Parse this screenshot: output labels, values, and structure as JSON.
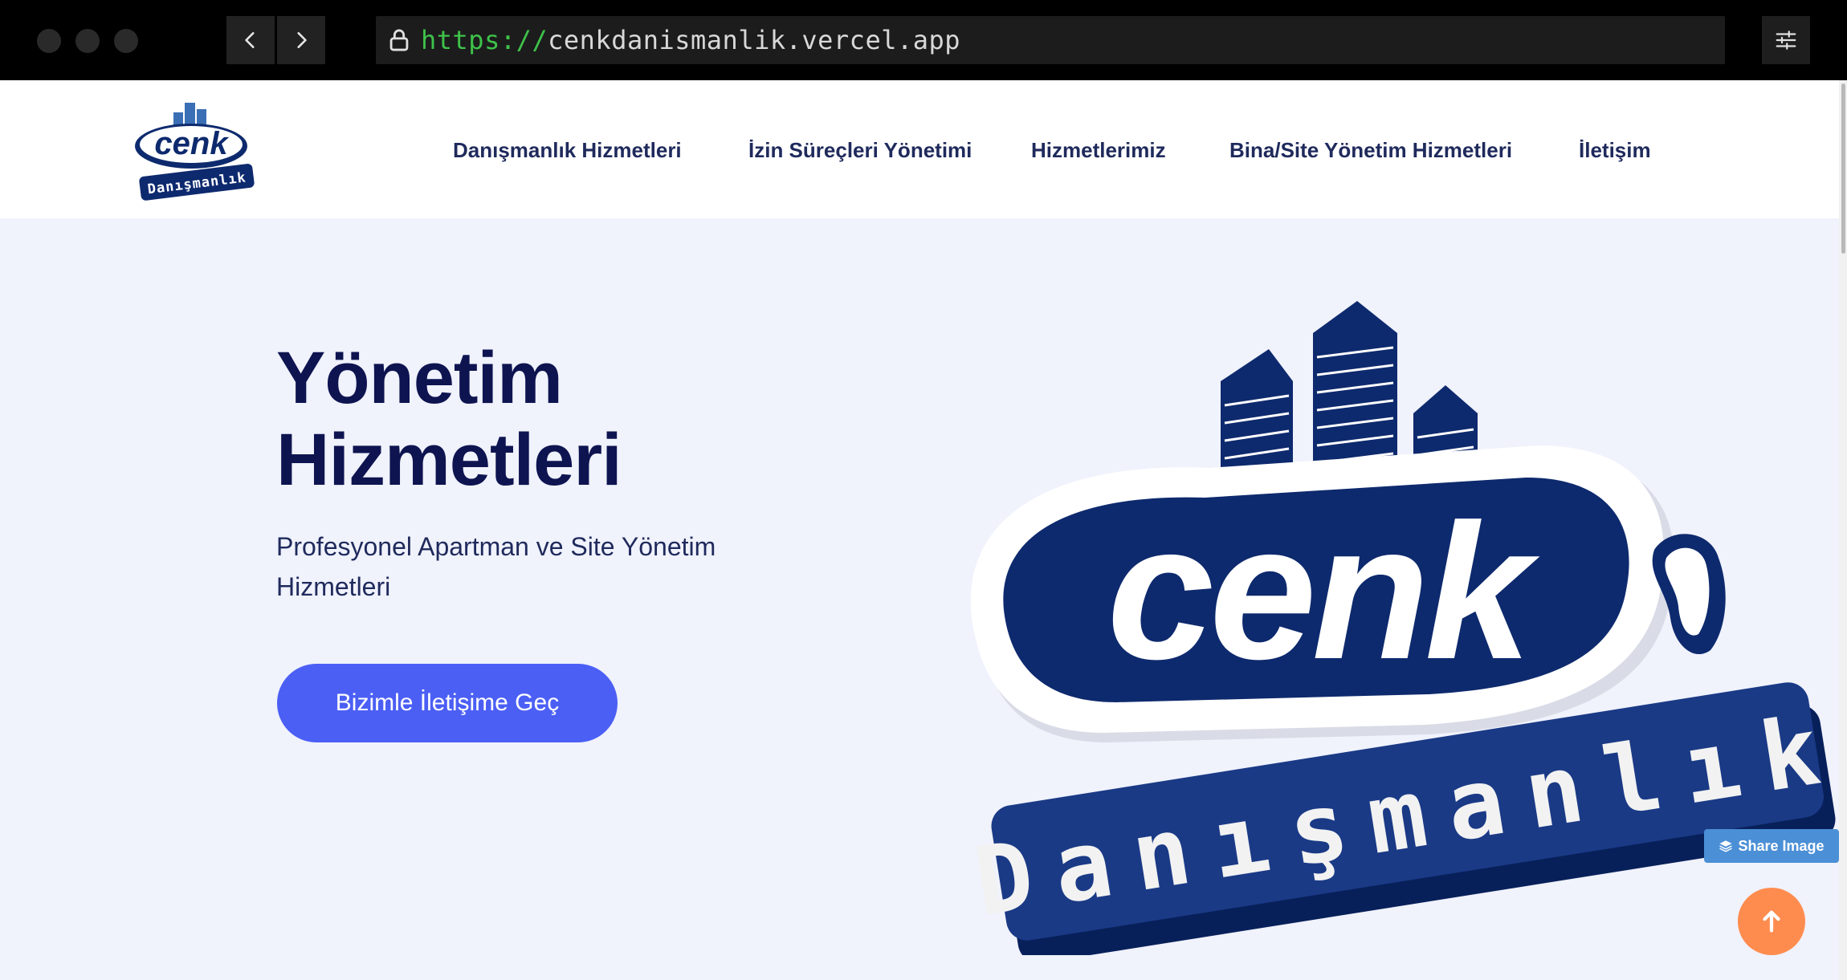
{
  "browser": {
    "url_scheme": "https://",
    "url_host": "cenkdanismanlik.vercel.app"
  },
  "logo": {
    "word": "cenk",
    "subword": "Danışmanlık"
  },
  "nav": {
    "items": [
      "Danışmanlık Hizmetleri",
      "İzin Süreçleri Yönetimi",
      "Hizmetlerimiz",
      "Bina/Site Yönetim Hizmetleri",
      "İletişim"
    ]
  },
  "hero": {
    "title_line1": "Yönetim",
    "title_line2": "Hizmetleri",
    "subtitle": "Profesyonel Apartman ve Site Yönetim Hizmetleri",
    "cta_label": "Bizimle İletişime Geç"
  },
  "widgets": {
    "share_label": "Share Image"
  },
  "colors": {
    "brand_navy": "#0e2a6e",
    "heading": "#0e1450",
    "accent": "#4b5ff5",
    "share": "#4b8fd6",
    "top_button": "#ff8c4f",
    "hero_bg": "#f0f2fc"
  }
}
